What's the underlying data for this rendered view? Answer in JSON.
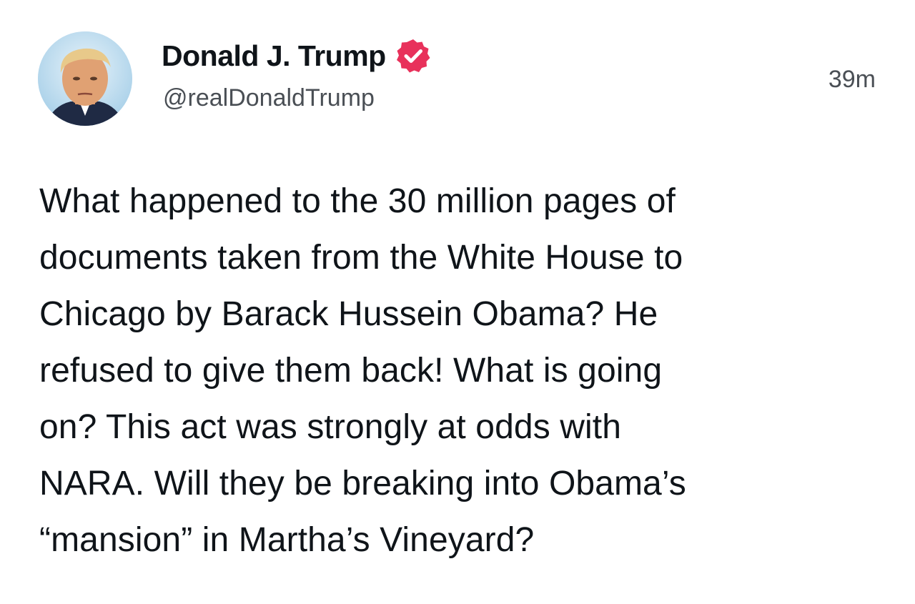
{
  "post": {
    "author": {
      "display_name": "Donald J. Trump",
      "handle": "@realDonaldTrump",
      "verified": true,
      "avatar_icon": "avatar-photo"
    },
    "timestamp": "39m",
    "text": "What happened to the 30 million pages of\ndocuments taken from the White House to\nChicago by Barack Hussein Obama? He\nrefused to give them back! What is going\non? This act was strongly at odds with\nNARA. Will they be breaking into Obama’s\n“mansion” in Martha’s Vineyard?"
  },
  "colors": {
    "verified_badge": "#e8315b",
    "text_primary": "#0f1419",
    "text_secondary": "#4a4f55"
  }
}
